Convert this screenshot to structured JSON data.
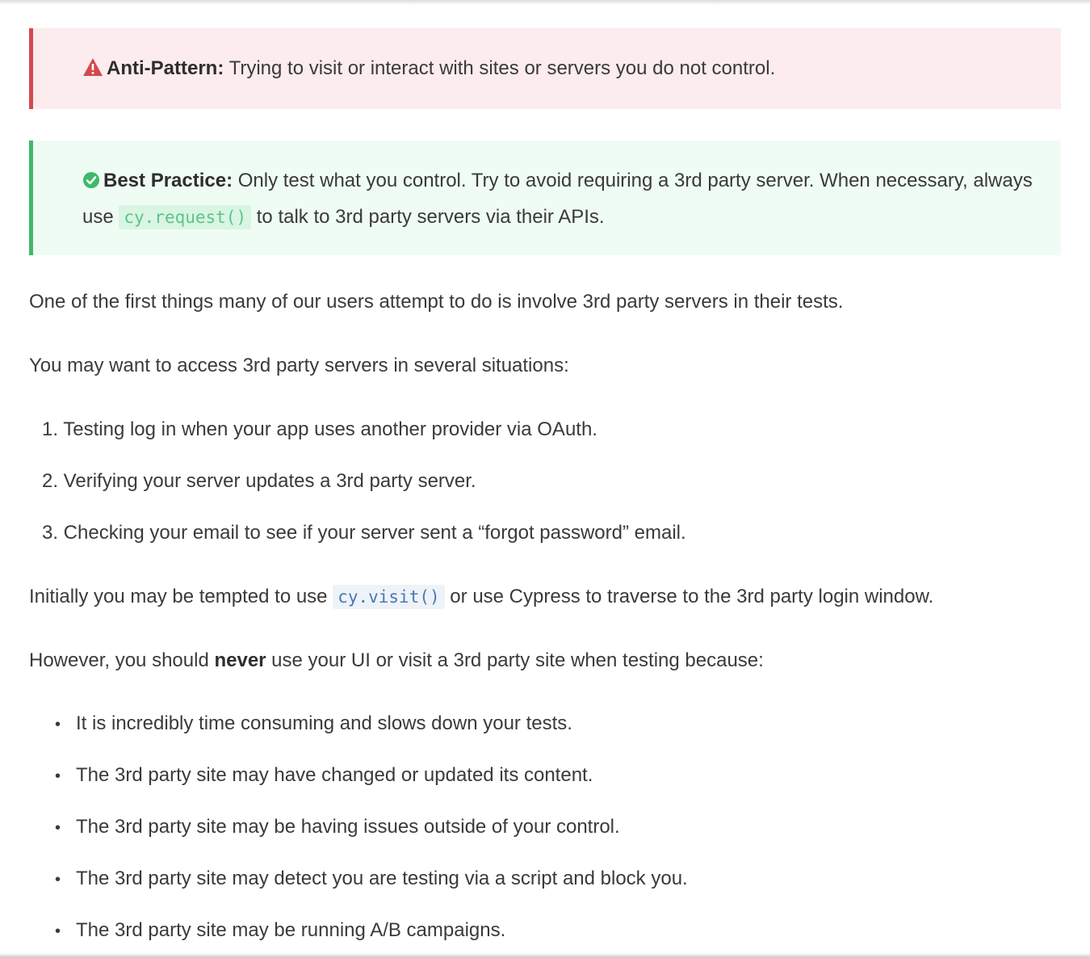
{
  "anti_pattern": {
    "label": "Anti-Pattern:",
    "text": " Trying to visit or interact with sites or servers you do not control.",
    "icon": "warning-triangle-icon",
    "accent_color": "#d44950"
  },
  "best_practice": {
    "label": "Best Practice:",
    "text_before": " Only test what you control. Try to avoid requiring a 3rd party server. When necessary, always use ",
    "code": "cy.request()",
    "text_after": " to talk to 3rd party servers via their APIs.",
    "icon": "check-circle-icon",
    "accent_color": "#3fb96b"
  },
  "intro": "One of the first things many of our users attempt to do is involve 3rd party servers in their tests.",
  "situations_intro": "You may want to access 3rd party servers in several situations:",
  "situations": [
    "1. Testing log in when your app uses another provider via OAuth.",
    "2. Verifying your server updates a 3rd party server.",
    "3. Checking your email to see if your server sent a “forgot password” email."
  ],
  "tempted": {
    "before": "Initially you may be tempted to use ",
    "code": "cy.visit()",
    "after": " or use Cypress to traverse to the 3rd party login window."
  },
  "however": {
    "before": "However, you should ",
    "bold": "never",
    "after": " use your UI or visit a 3rd party site when testing because:"
  },
  "reasons": [
    "It is incredibly time consuming and slows down your tests.",
    "The 3rd party site may have changed or updated its content.",
    "The 3rd party site may be having issues outside of your control.",
    "The 3rd party site may detect you are testing via a script and block you.",
    "The 3rd party site may be running A/B campaigns."
  ]
}
